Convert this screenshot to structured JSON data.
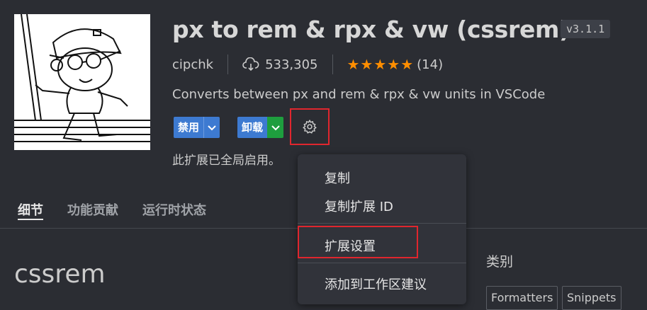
{
  "extension": {
    "title": "px to rem & rpx & vw (cssrem)",
    "version": "v3.1.1",
    "publisher": "cipchk",
    "downloads": "533,305",
    "stars": "★★★★★",
    "rating_count": "(14)",
    "description": "Converts between px and rem & rpx & vw units in VSCode",
    "status": "此扩展已全局启用。"
  },
  "actions": {
    "disable_label": "禁用",
    "uninstall_label": "卸载"
  },
  "tabs": [
    {
      "label": "细节"
    },
    {
      "label": "功能贡献"
    },
    {
      "label": "运行时状态"
    }
  ],
  "readme": {
    "title": "cssrem"
  },
  "categories": {
    "title": "类别",
    "items": [
      "Formatters",
      "Snippets"
    ]
  },
  "context_menu": {
    "items": [
      {
        "label": "复制"
      },
      {
        "label": "复制扩展 ID"
      },
      {
        "label": "扩展设置"
      },
      {
        "label": "添加到工作区建议"
      }
    ]
  },
  "colors": {
    "background": "#2b2d33",
    "primary_button": "#3d7ad1",
    "green_accent": "#1e9e3e",
    "star": "#ff8e00",
    "highlight_box": "#e0262e"
  }
}
